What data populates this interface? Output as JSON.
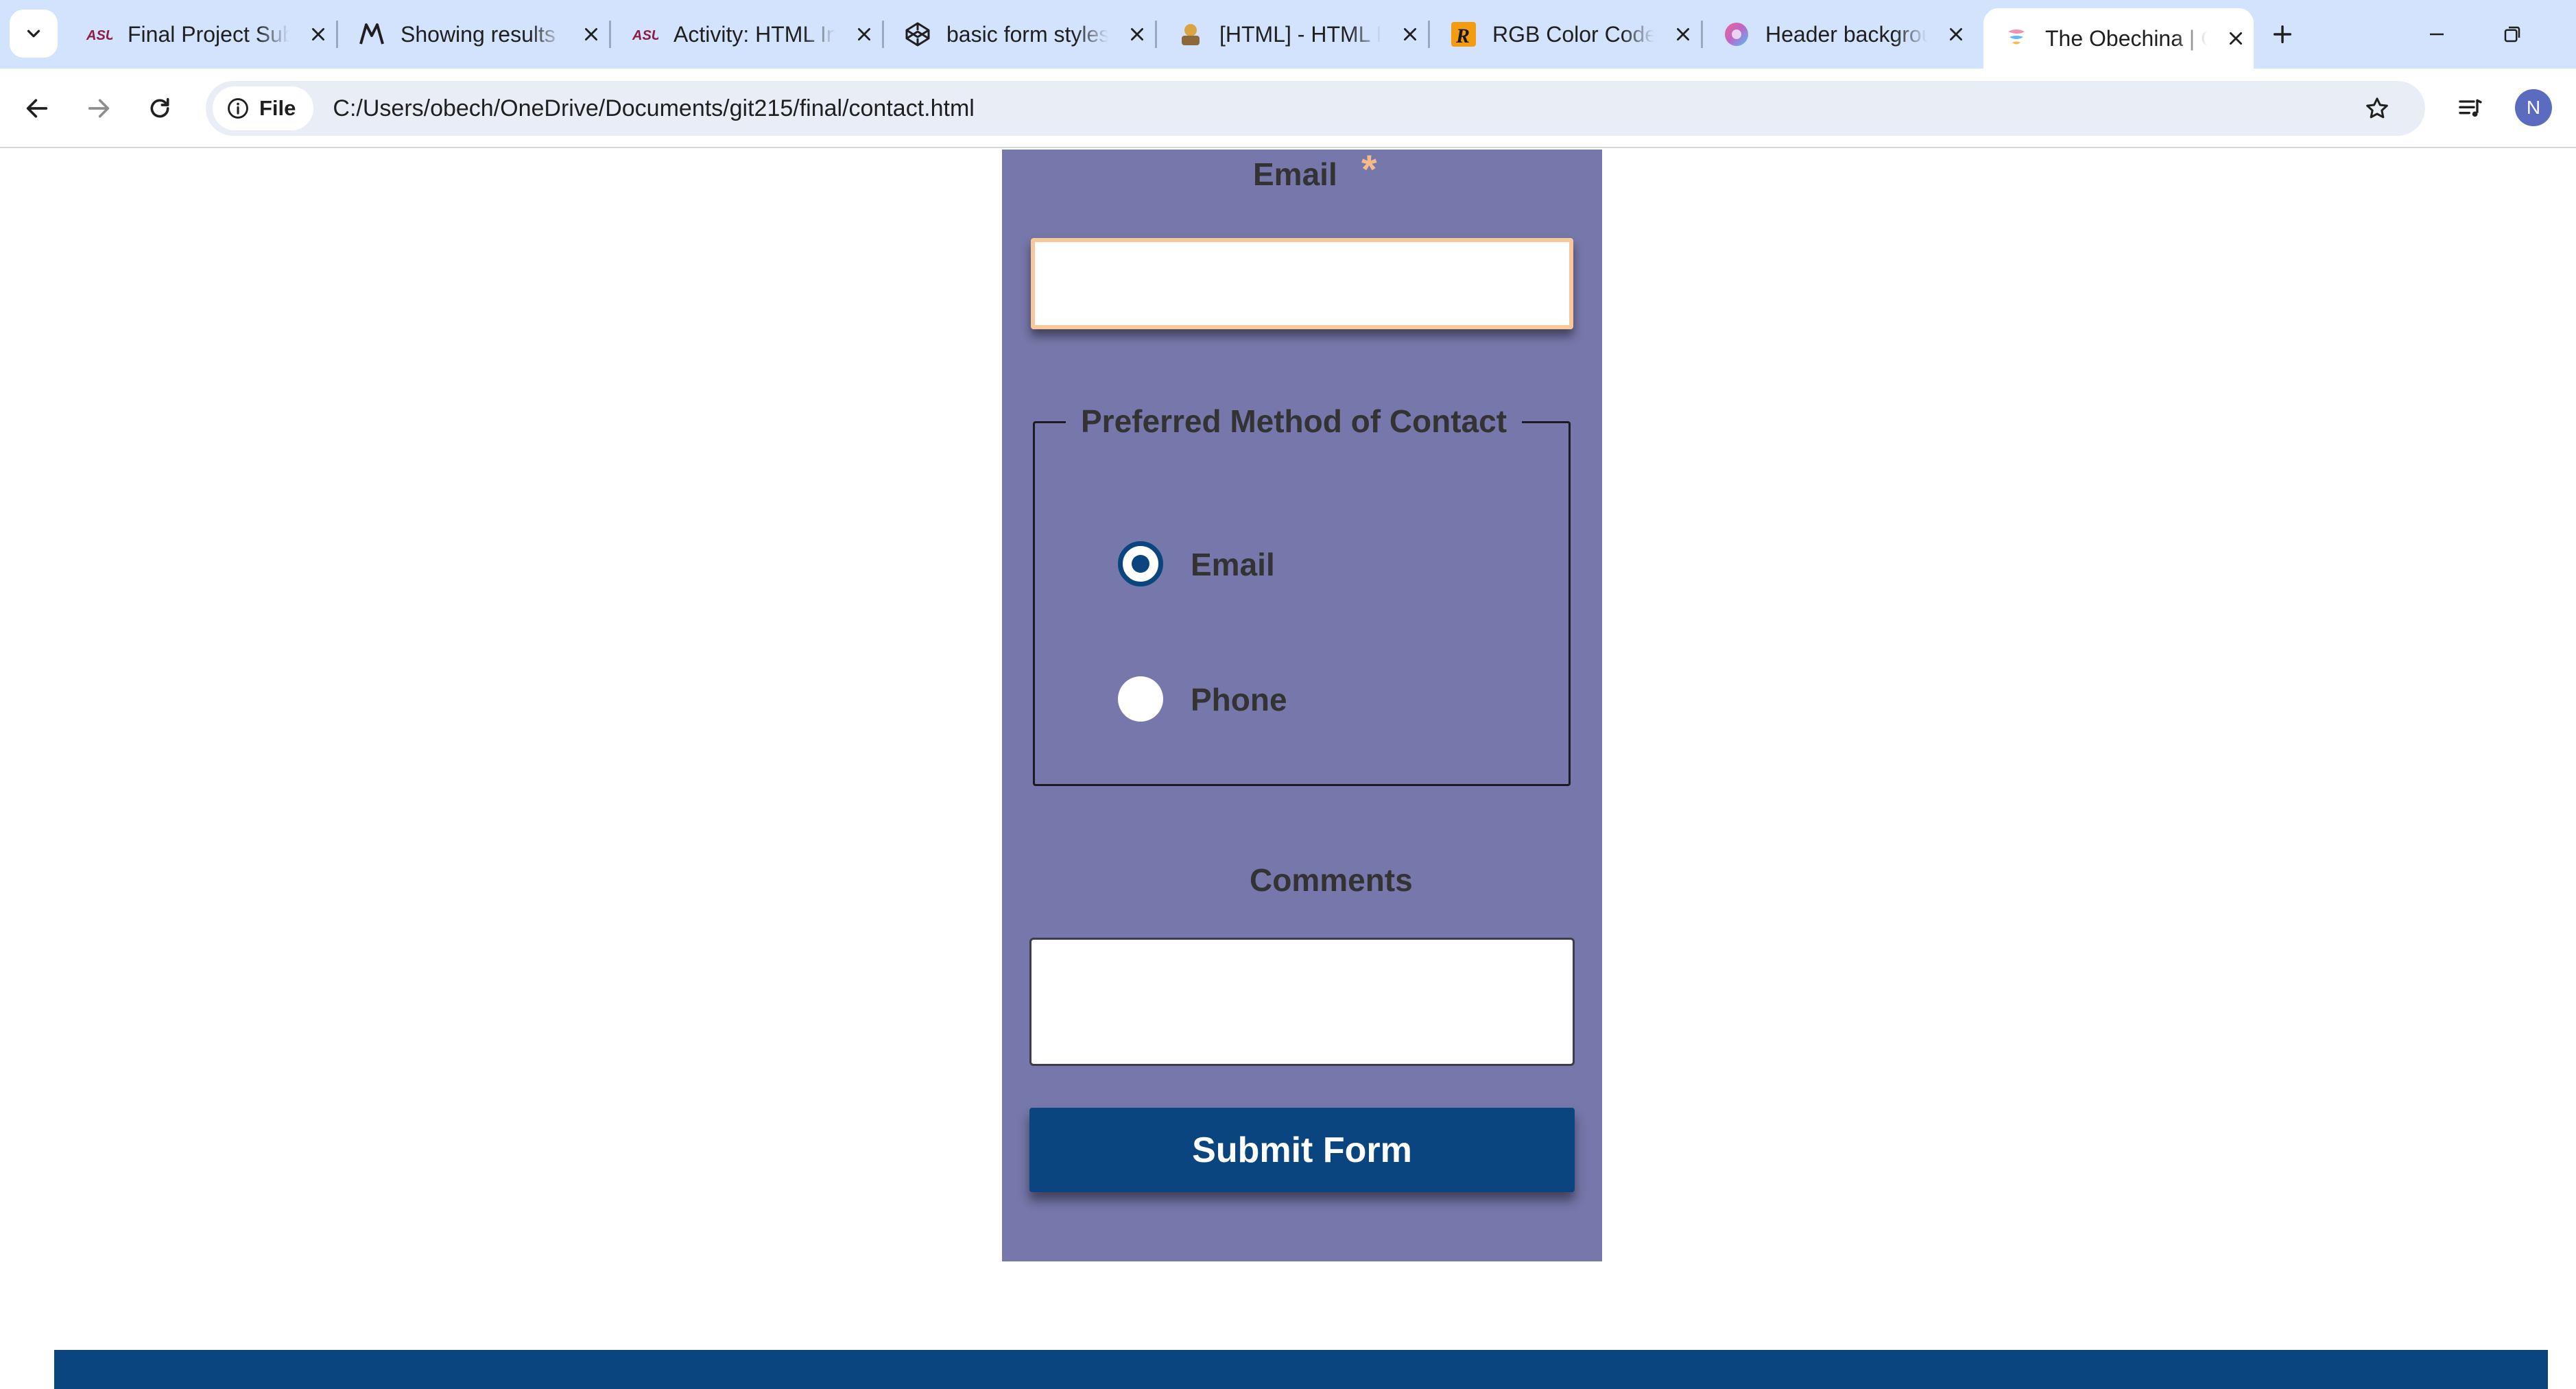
{
  "browser": {
    "tabs": [
      {
        "title": "Final Project Sub",
        "favicon": "asu-icon"
      },
      {
        "title": "Showing results",
        "favicon": "mdn-icon"
      },
      {
        "title": "Activity: HTML In",
        "favicon": "asu-icon"
      },
      {
        "title": "basic form styles",
        "favicon": "codepen-icon"
      },
      {
        "title": "[HTML] - HTML I",
        "favicon": "reference-icon"
      },
      {
        "title": "RGB Color Code",
        "favicon": "rapidtables-icon"
      },
      {
        "title": "Header backgrou",
        "favicon": "gradient-icon"
      },
      {
        "title": "The Obechina | C",
        "favicon": "site-icon",
        "active": true
      }
    ],
    "address": {
      "chip_label": "File",
      "url": "C:/Users/obech/OneDrive/Documents/git215/final/contact.html"
    },
    "profile_initial": "N"
  },
  "form": {
    "email_label": "Email",
    "required_mark": "*",
    "email_value": "",
    "fieldset_legend": "Preferred Method of Contact",
    "contact_options": [
      {
        "label": "Email",
        "checked": true
      },
      {
        "label": "Phone",
        "checked": false
      }
    ],
    "comments_label": "Comments",
    "comments_value": "",
    "submit_label": "Submit Form"
  },
  "colors": {
    "panel": "#7677aa",
    "accent": "#0b4580",
    "input_focus_border": "#f8c79a",
    "required": "#f6b987"
  }
}
